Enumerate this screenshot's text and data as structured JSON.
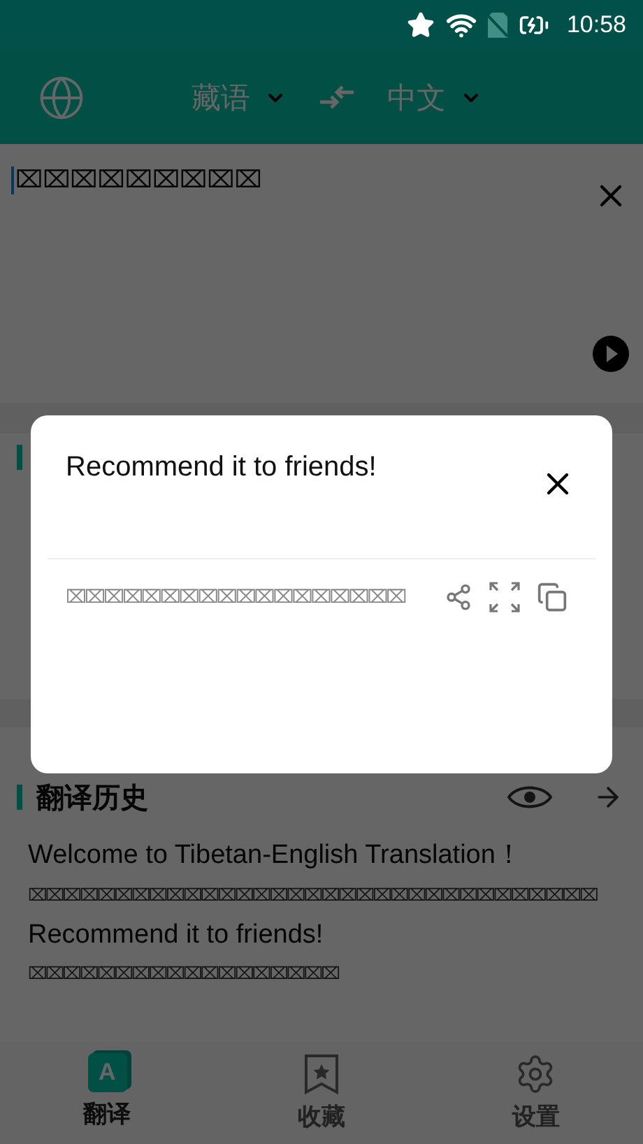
{
  "status_bar": {
    "time": "10:58"
  },
  "header": {
    "source_language": "藏语",
    "target_language": "中文"
  },
  "input": {
    "value": "⌧⌧⌧⌧⌧⌧⌧⌧⌧"
  },
  "history": {
    "title": "翻译历史",
    "items": [
      {
        "source": "Welcome to Tibetan-English Translation！",
        "target": "⌧⌧⌧⌧⌧⌧⌧⌧⌧⌧⌧⌧⌧⌧⌧⌧⌧⌧⌧⌧⌧⌧⌧⌧⌧⌧⌧⌧⌧⌧⌧⌧⌧"
      },
      {
        "source": "Recommend it to friends!",
        "target": "⌧⌧⌧⌧⌧⌧⌧⌧⌧⌧⌧⌧⌧⌧⌧⌧⌧⌧"
      }
    ]
  },
  "dialog": {
    "title": "Recommend it to friends!",
    "result": "⌧⌧⌧⌧⌧⌧⌧⌧⌧⌧⌧⌧⌧⌧⌧⌧⌧⌧"
  },
  "nav": [
    {
      "kind": "translate",
      "label": "翻译",
      "icon_letter": "A",
      "selected": true
    },
    {
      "kind": "favorites",
      "label": "收藏",
      "selected": false
    },
    {
      "kind": "settings",
      "label": "设置",
      "selected": false
    }
  ]
}
